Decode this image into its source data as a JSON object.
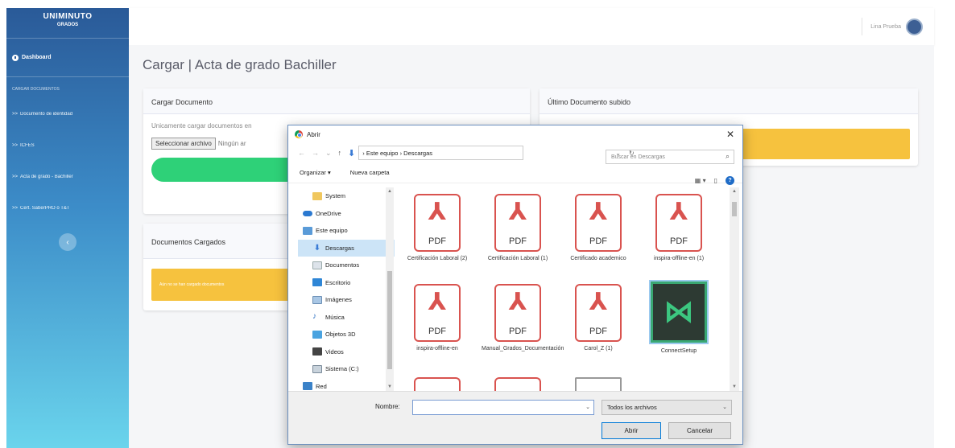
{
  "sidebar": {
    "brand": "UNIMINUTO",
    "brand_sub": "GRADOS",
    "dashboard": "Dashboard",
    "section_heading": "CARGAR DOCUMENTOS",
    "items": [
      {
        "label": "Documento de identidad"
      },
      {
        "label": "ICFES"
      },
      {
        "label": "Acta de grado - Bachiller"
      },
      {
        "label": "Cert. SaberPRO ó T&T"
      }
    ],
    "toggle_icon": "chevron-left-icon"
  },
  "topbar": {
    "user_name": "Lina Prueba"
  },
  "main": {
    "page_title": "Cargar | Acta de grado Bachiller",
    "upload_card": {
      "title": "Cargar Documento",
      "hint": "Unicamente cargar documentos en",
      "choose_file": "Seleccionar archivo",
      "no_file": "Ningún ar"
    },
    "last_card": {
      "title": "Último Documento subido"
    },
    "loaded_card": {
      "title": "Documentos Cargados",
      "alert": "Aún no se han cargado documentos"
    }
  },
  "dialog": {
    "title": "Abrir",
    "breadcrumb": [
      "Este equipo",
      "Descargas"
    ],
    "search_placeholder": "Buscar en Descargas",
    "organize": "Organizar ▾",
    "new_folder": "Nueva carpeta",
    "nav_items": [
      {
        "label": "System",
        "icon": "folder-icon"
      },
      {
        "label": "OneDrive",
        "icon": "cloud-icon"
      },
      {
        "label": "Este equipo",
        "icon": "computer-icon"
      },
      {
        "label": "Descargas",
        "icon": "download-icon",
        "selected": true
      },
      {
        "label": "Documentos",
        "icon": "document-icon"
      },
      {
        "label": "Escritorio",
        "icon": "desktop-icon"
      },
      {
        "label": "Imágenes",
        "icon": "pictures-icon"
      },
      {
        "label": "Música",
        "icon": "music-icon"
      },
      {
        "label": "Objetos 3D",
        "icon": "cube-icon"
      },
      {
        "label": "Videos",
        "icon": "video-icon"
      },
      {
        "label": "Sistema (C:)",
        "icon": "drive-icon"
      },
      {
        "label": "Red",
        "icon": "network-icon"
      }
    ],
    "files": [
      {
        "name": "Certificación Laboral (2)",
        "type": "pdf"
      },
      {
        "name": "Certificación Laboral (1)",
        "type": "pdf"
      },
      {
        "name": "Certificado academico",
        "type": "pdf"
      },
      {
        "name": "inspira-offline-en (1)",
        "type": "pdf"
      },
      {
        "name": "inspira-offline-en",
        "type": "pdf"
      },
      {
        "name": "Manual_Grados_Documentación",
        "type": "pdf"
      },
      {
        "name": "Carol_Z (1)",
        "type": "pdf"
      },
      {
        "name": "ConnectSetup",
        "type": "app"
      }
    ],
    "pdf_label": "PDF",
    "name_label": "Nombre:",
    "name_value": "",
    "filter": "Todos los archivos",
    "open_button": "Abrir",
    "cancel_button": "Cancelar"
  },
  "colors": {
    "sidebar_top": "#2a5a98",
    "sidebar_bottom": "#6ad4ec",
    "success": "#2ed178",
    "warning": "#f6c23e",
    "pdf_red": "#d9534f"
  }
}
